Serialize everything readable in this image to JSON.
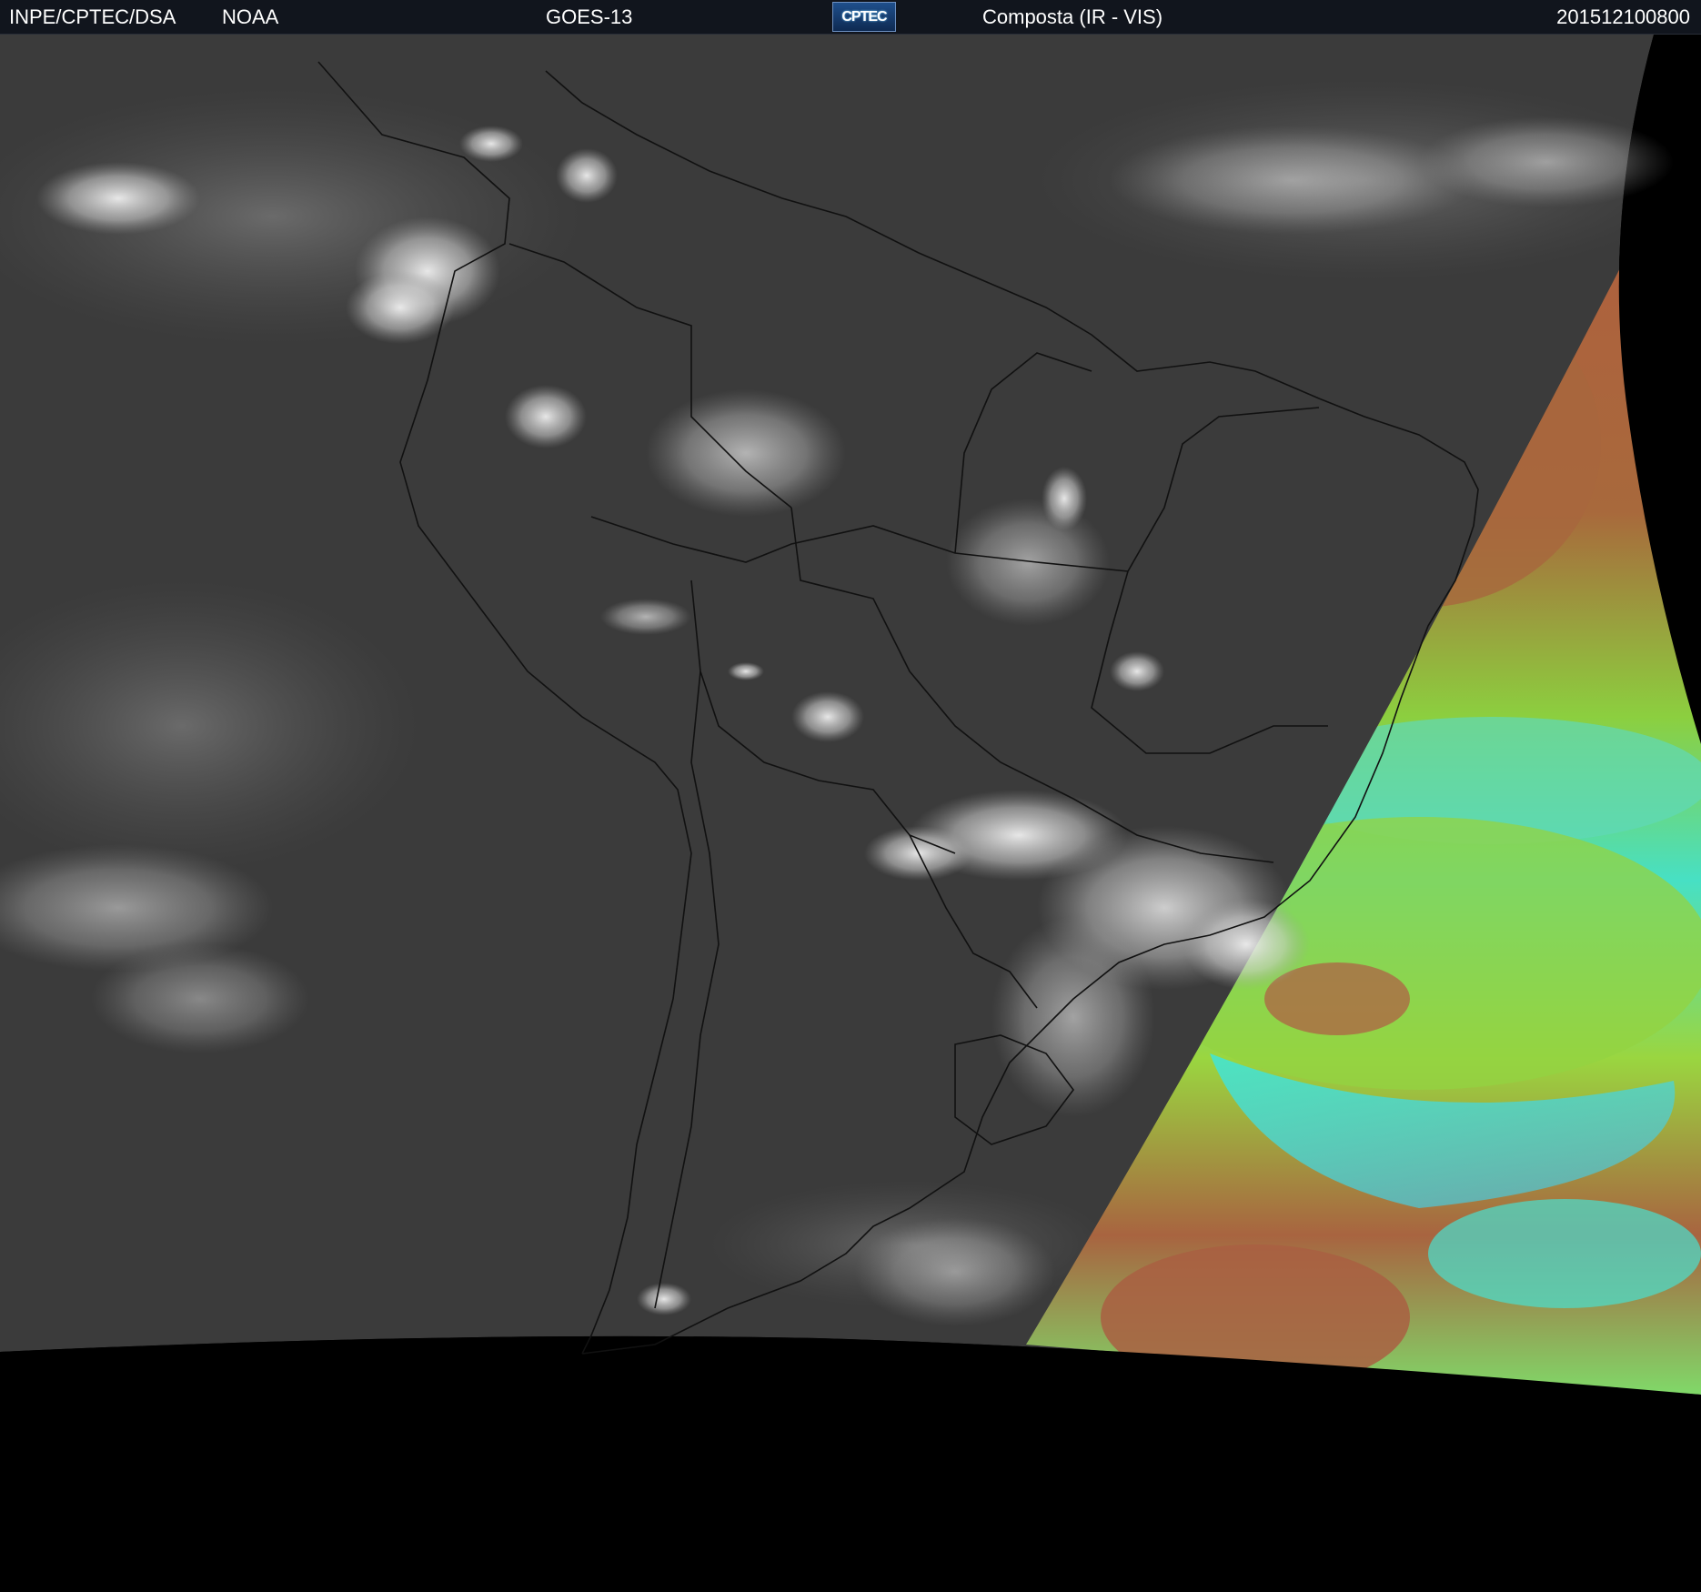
{
  "header": {
    "agency": "INPE/CPTEC/DSA",
    "partner": "NOAA",
    "satellite": "GOES-13",
    "logo_text": "CPTEC",
    "product": "Composta (IR - VIS)",
    "datetime": "201512100800"
  },
  "imagery": {
    "region": "South America",
    "background_color": "#000000",
    "ir_tone_color": "#3a3a3a",
    "cloud_color": "#d8d8d8",
    "vis_palette": [
      "#b0583f",
      "#8ccc3c",
      "#3fe0d0"
    ],
    "border_color": "#111111"
  }
}
